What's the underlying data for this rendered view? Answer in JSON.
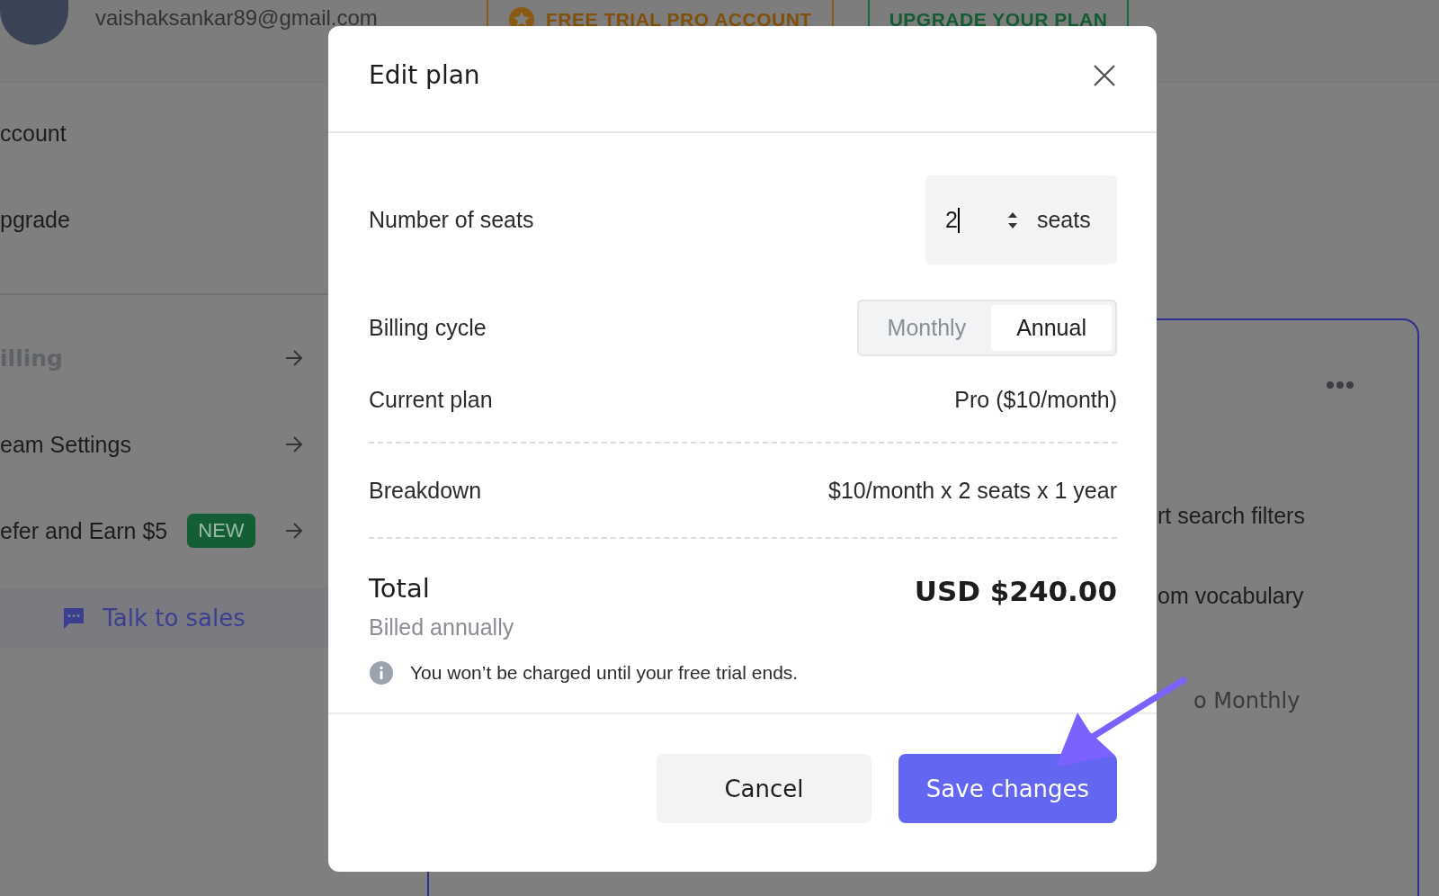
{
  "header": {
    "email": "vaishaksankar89@gmail.com",
    "buttons": [
      {
        "label": "FREE TRIAL PRO ACCOUNT",
        "kind": "trial"
      },
      {
        "label": "UPGRADE YOUR PLAN",
        "kind": "upgrade"
      }
    ]
  },
  "sidebar": {
    "top_items": [
      {
        "label": "ccount"
      },
      {
        "label": "pgrade"
      }
    ],
    "items": [
      {
        "label": "illing",
        "selected": true
      },
      {
        "label": "eam Settings",
        "selected": false
      },
      {
        "label": "efer and Earn $5",
        "selected": false,
        "badge": "NEW"
      }
    ],
    "talk_button": "Talk to sales"
  },
  "plan_card": {
    "features": [
      "rt search filters",
      "om vocabulary",
      "o Monthly"
    ]
  },
  "dialog": {
    "title": "Edit plan",
    "seats": {
      "label": "Number of seats",
      "value": "2",
      "unit": "seats"
    },
    "billing": {
      "label": "Billing cycle",
      "options": [
        {
          "label": "Monthly",
          "selected": false
        },
        {
          "label": "Annual",
          "selected": true
        }
      ]
    },
    "rows": [
      {
        "label": "Current plan",
        "value": "Pro ($10/month)"
      },
      {
        "label": "Breakdown",
        "value": "$10/month x 2 seats x 1 year"
      }
    ],
    "total": {
      "label": "Total",
      "amount": "USD $240.00",
      "note": "Billed annually"
    },
    "info": "You won’t be charged until your free trial ends.",
    "buttons": [
      {
        "label": "Cancel",
        "kind": "secondary"
      },
      {
        "label": "Save changes",
        "kind": "primary"
      }
    ]
  }
}
